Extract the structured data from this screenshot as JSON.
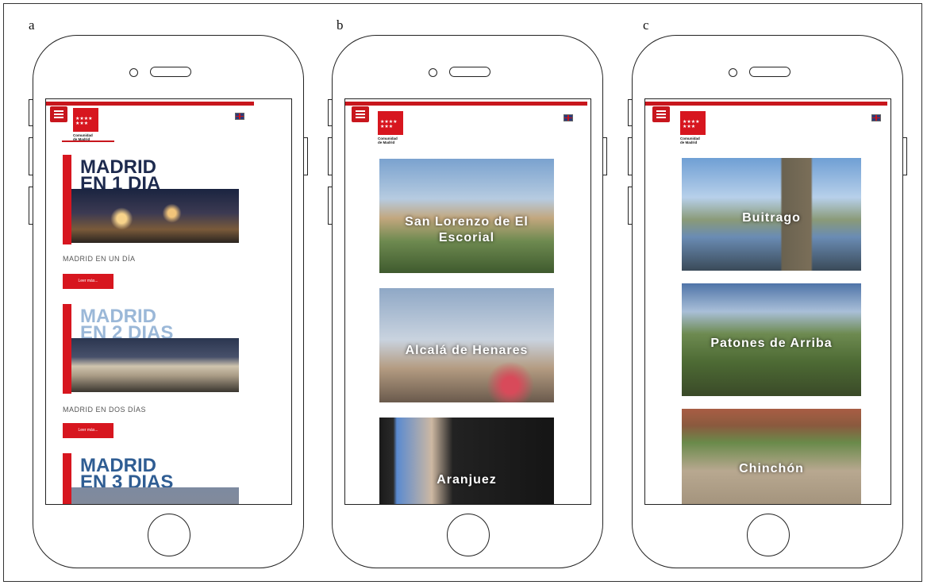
{
  "panels": [
    {
      "label": "a"
    },
    {
      "label": "b"
    },
    {
      "label": "c"
    }
  ],
  "logo": {
    "line1": "Comunidad",
    "line2": "de Madrid",
    "stars": "★★★★ ★★★"
  },
  "panel_a": {
    "promos": [
      {
        "title_line1": "MADRID",
        "title_line2": "EN 1 DIA",
        "caption": "MADRID EN UN DÍA"
      },
      {
        "title_line1": "MADRID",
        "title_line2": "EN 2 DIAS",
        "caption": "MADRID EN DOS DÍAS"
      },
      {
        "title_line1": "MADRID",
        "title_line2": "EN 3 DIAS"
      }
    ],
    "leer_label": "Leer más..."
  },
  "panel_b": {
    "cards": [
      {
        "label_line1": "San Lorenzo de El",
        "label_line2": "Escorial"
      },
      {
        "label": "Alcalá de Henares"
      },
      {
        "label": "Aranjuez"
      }
    ]
  },
  "panel_c": {
    "cards": [
      {
        "label": "Buitrago"
      },
      {
        "label": "Patones de Arriba"
      },
      {
        "label": "Chinchón"
      }
    ]
  },
  "colors": {
    "brand_red": "#d7161f",
    "navy_title": "#1d2a4e"
  },
  "icons": {
    "menu": "hamburger-icon",
    "language": "uk-flag-icon"
  }
}
